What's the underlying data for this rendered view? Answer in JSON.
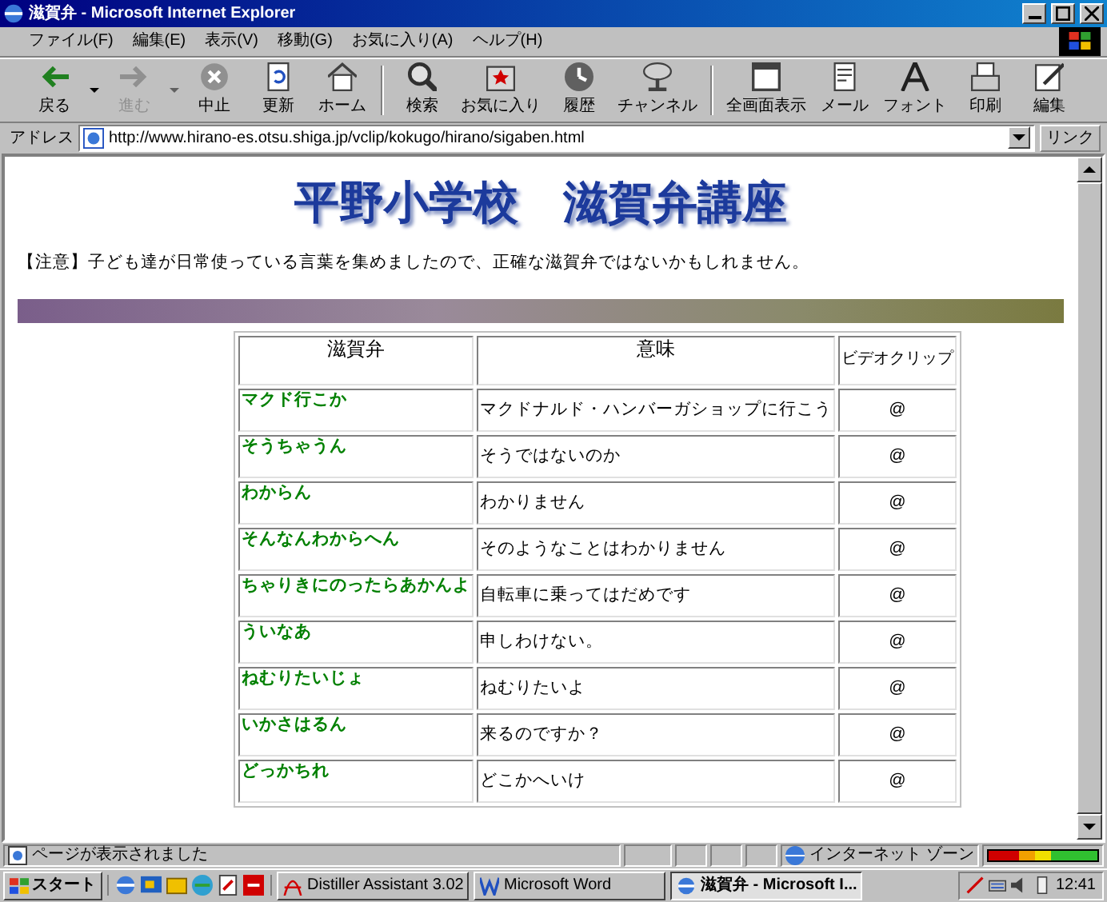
{
  "window": {
    "title": "滋賀弁 - Microsoft Internet Explorer"
  },
  "menu": [
    "ファイル(F)",
    "編集(E)",
    "表示(V)",
    "移動(G)",
    "お気に入り(A)",
    "ヘルプ(H)"
  ],
  "toolbar": [
    {
      "label": "戻る",
      "dropdown": true,
      "disabled": false
    },
    {
      "label": "進む",
      "dropdown": true,
      "disabled": true
    },
    {
      "label": "中止",
      "dropdown": false,
      "disabled": false
    },
    {
      "label": "更新",
      "dropdown": false,
      "disabled": false
    },
    {
      "label": "ホーム",
      "dropdown": false,
      "disabled": false
    },
    {
      "label": "検索",
      "dropdown": false,
      "disabled": false
    },
    {
      "label": "お気に入り",
      "dropdown": false,
      "disabled": false
    },
    {
      "label": "履歴",
      "dropdown": false,
      "disabled": false
    },
    {
      "label": "チャンネル",
      "dropdown": false,
      "disabled": false
    },
    {
      "label": "全画面表示",
      "dropdown": false,
      "disabled": false
    },
    {
      "label": "メール",
      "dropdown": false,
      "disabled": false
    },
    {
      "label": "フォント",
      "dropdown": false,
      "disabled": false
    },
    {
      "label": "印刷",
      "dropdown": false,
      "disabled": false
    },
    {
      "label": "編集",
      "dropdown": false,
      "disabled": false
    }
  ],
  "address": {
    "label": "アドレス",
    "url": "http://www.hirano-es.otsu.shiga.jp/vclip/kokugo/hirano/sigaben.html",
    "links": "リンク"
  },
  "page": {
    "heading": "平野小学校　滋賀弁講座",
    "notice": "【注意】子ども達が日常使っている言葉を集めましたので、正確な滋賀弁ではないかもしれません。",
    "table": {
      "columns": [
        "滋賀弁",
        "意味",
        "ビデオクリップ"
      ],
      "rows": [
        {
          "dialect": "マクド行こか",
          "meaning": "マクドナルド・ハンバーガショップに行こう",
          "clip": "@"
        },
        {
          "dialect": "そうちゃうん",
          "meaning": "そうではないのか",
          "clip": "@"
        },
        {
          "dialect": "わからん",
          "meaning": "わかりません",
          "clip": "@"
        },
        {
          "dialect": "そんなんわからへん",
          "meaning": "そのようなことはわかりません",
          "clip": "@"
        },
        {
          "dialect": "ちゃりきにのったらあかんよ",
          "meaning": "自転車に乗ってはだめです",
          "clip": "@"
        },
        {
          "dialect": "ういなあ",
          "meaning": "申しわけない。",
          "clip": "@"
        },
        {
          "dialect": "ねむりたいじょ",
          "meaning": "ねむりたいよ",
          "clip": "@"
        },
        {
          "dialect": "いかさはるん",
          "meaning": "来るのですか？",
          "clip": "@"
        },
        {
          "dialect": "どっかちれ",
          "meaning": "どこかへいけ",
          "clip": "@"
        }
      ]
    }
  },
  "status_bar": {
    "message": "ページが表示されました",
    "zone": "インターネット ゾーン"
  },
  "taskbar": {
    "start": "スタート",
    "tasks": [
      {
        "label": "Distiller Assistant 3.02",
        "selected": false
      },
      {
        "label": "Microsoft Word",
        "selected": false
      },
      {
        "label": "滋賀弁 - Microsoft I...",
        "selected": true
      }
    ],
    "clock": "12:41"
  }
}
